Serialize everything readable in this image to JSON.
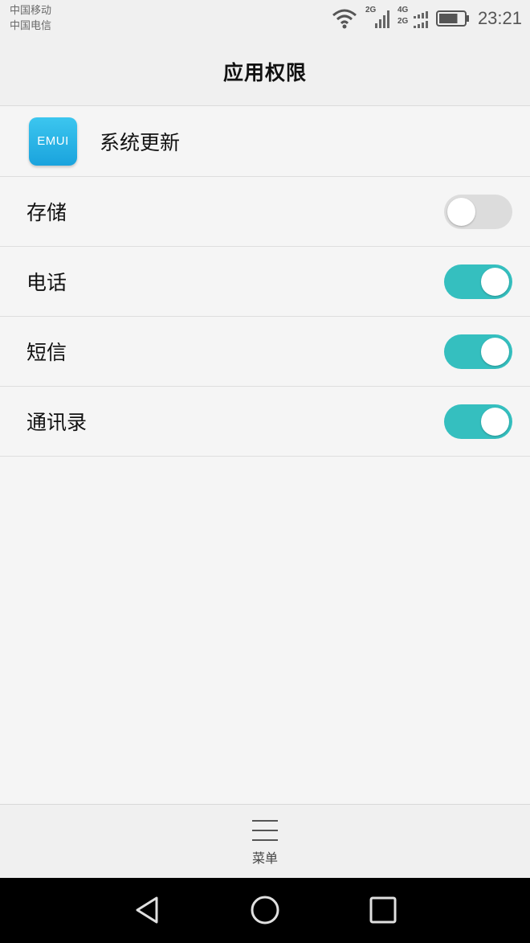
{
  "status_bar": {
    "carrier_1": "中国移动",
    "carrier_2": "中国电信",
    "network_1": "2G",
    "network_2a": "4G",
    "network_2b": "2G",
    "time": "23:21",
    "battery_level": 0.75
  },
  "header": {
    "title": "应用权限"
  },
  "app": {
    "name": "系统更新",
    "icon_text": "EMUI",
    "icon_color": "#1aa3dd"
  },
  "permissions": [
    {
      "label": "存储",
      "enabled": false
    },
    {
      "label": "电话",
      "enabled": true
    },
    {
      "label": "短信",
      "enabled": true
    },
    {
      "label": "通讯录",
      "enabled": true
    }
  ],
  "bottom_menu": {
    "label": "菜单"
  },
  "colors": {
    "toggle_on": "#35bfbf",
    "toggle_off": "#dcdcdc"
  },
  "nav": {
    "back": "back-icon",
    "home": "home-icon",
    "recents": "recents-icon"
  }
}
